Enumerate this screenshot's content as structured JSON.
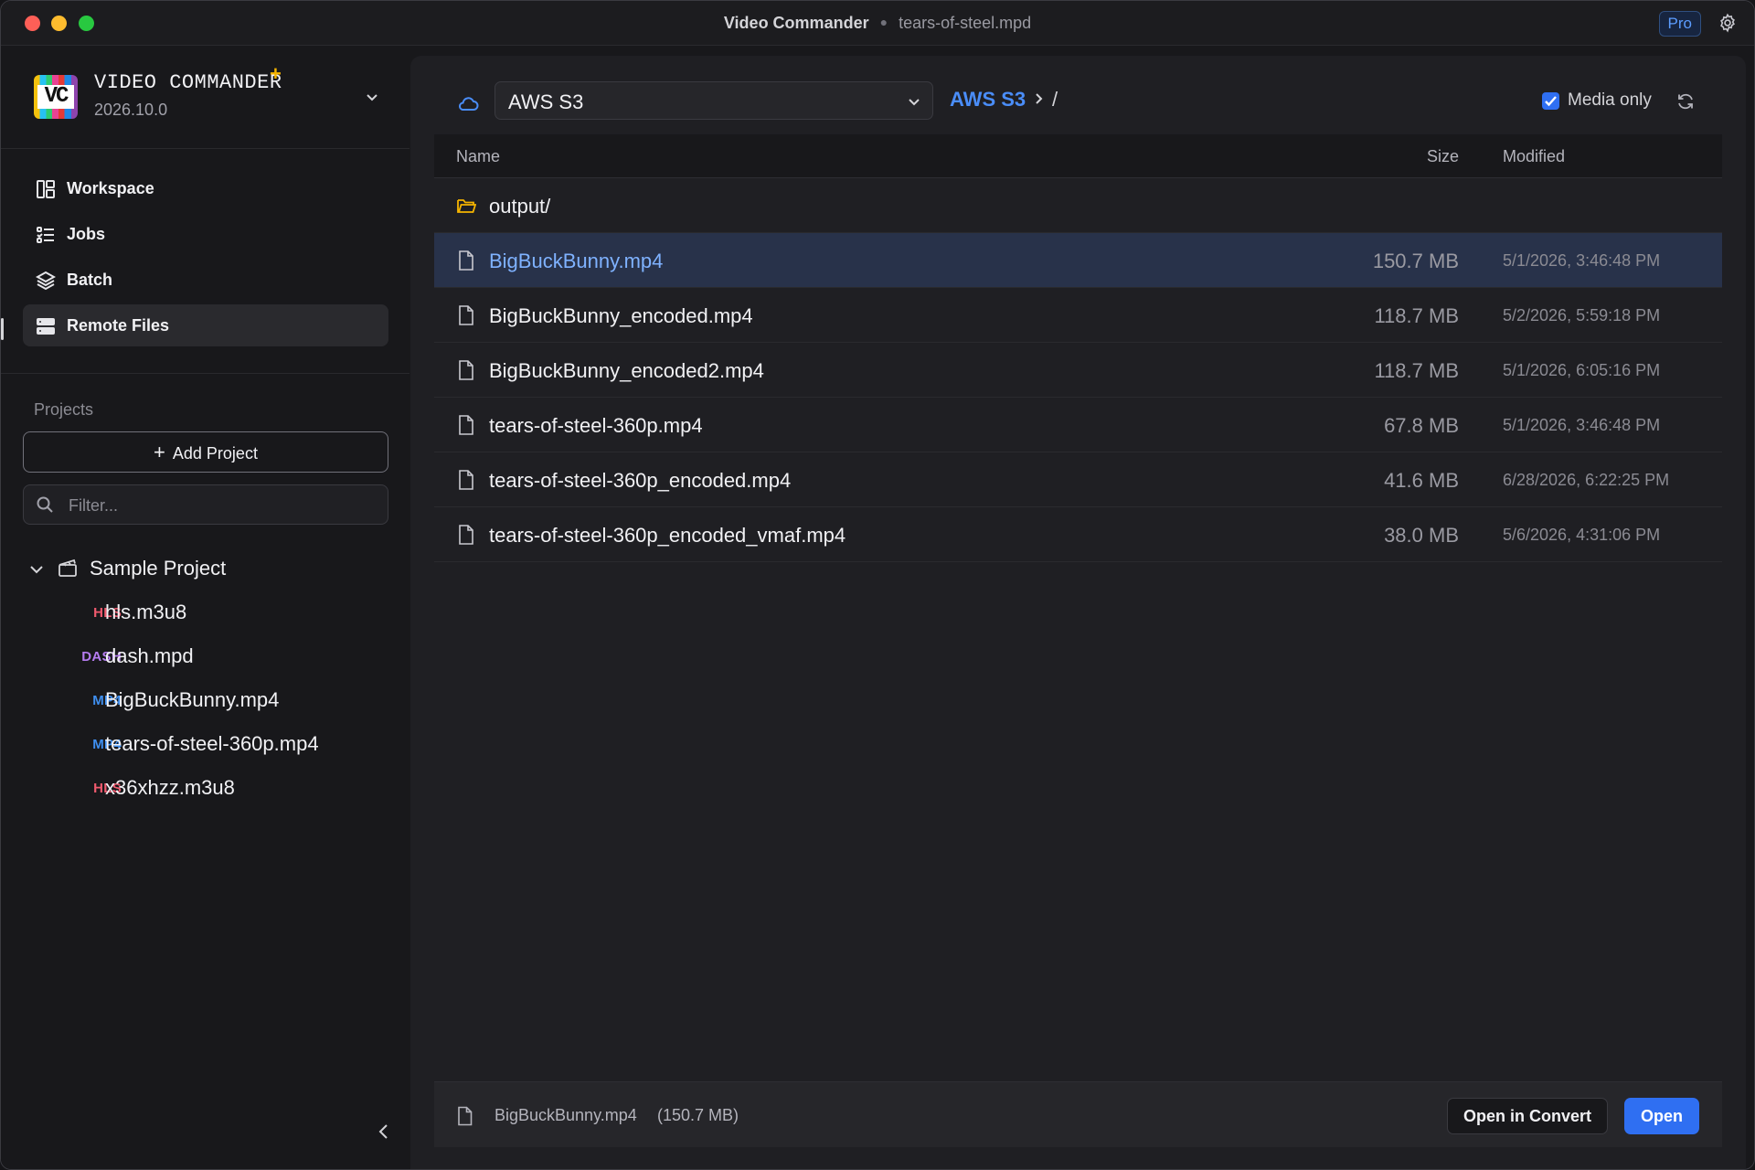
{
  "window": {
    "app_title": "Video Commander",
    "separator": "●",
    "document_title": "tears-of-steel.mpd",
    "pro_badge": "Pro"
  },
  "brand": {
    "logo_text": "VC",
    "name": "VIDEO COMMANDER",
    "star": "+",
    "version": "2026.10.0"
  },
  "nav": {
    "items": [
      {
        "label": "Workspace",
        "icon": "layout-icon",
        "active": false
      },
      {
        "label": "Jobs",
        "icon": "list-icon",
        "active": false
      },
      {
        "label": "Batch",
        "icon": "layers-icon",
        "active": false
      },
      {
        "label": "Remote Files",
        "icon": "server-icon",
        "active": true
      }
    ]
  },
  "projects": {
    "heading": "Projects",
    "add_label": "Add Project",
    "filter_placeholder": "Filter...",
    "tree": {
      "name": "Sample Project",
      "items": [
        {
          "badge": "HLS",
          "label": "hls.m3u8"
        },
        {
          "badge": "DASH",
          "label": "dash.mpd"
        },
        {
          "badge": "MP4",
          "label": "BigBuckBunny.mp4"
        },
        {
          "badge": "MP4",
          "label": "tears-of-steel-360p.mp4"
        },
        {
          "badge": "HLS",
          "label": "x36xhzz.m3u8"
        }
      ]
    }
  },
  "browser": {
    "source": "AWS S3",
    "breadcrumb_root": "AWS S3",
    "breadcrumb_path": "/",
    "media_only_label": "Media only",
    "media_only_checked": true,
    "columns": {
      "name": "Name",
      "size": "Size",
      "modified": "Modified"
    },
    "rows": [
      {
        "type": "folder",
        "name": "output/",
        "size": "",
        "modified": "",
        "selected": false
      },
      {
        "type": "file",
        "name": "BigBuckBunny.mp4",
        "size": "150.7 MB",
        "modified": "5/1/2026, 3:46:48 PM",
        "selected": true
      },
      {
        "type": "file",
        "name": "BigBuckBunny_encoded.mp4",
        "size": "118.7 MB",
        "modified": "5/2/2026, 5:59:18 PM",
        "selected": false
      },
      {
        "type": "file",
        "name": "BigBuckBunny_encoded2.mp4",
        "size": "118.7 MB",
        "modified": "5/1/2026, 6:05:16 PM",
        "selected": false
      },
      {
        "type": "file",
        "name": "tears-of-steel-360p.mp4",
        "size": "67.8 MB",
        "modified": "5/1/2026, 3:46:48 PM",
        "selected": false
      },
      {
        "type": "file",
        "name": "tears-of-steel-360p_encoded.mp4",
        "size": "41.6 MB",
        "modified": "6/28/2026, 6:22:25 PM",
        "selected": false
      },
      {
        "type": "file",
        "name": "tears-of-steel-360p_encoded_vmaf.mp4",
        "size": "38.0 MB",
        "modified": "5/6/2026, 4:31:06 PM",
        "selected": false
      }
    ]
  },
  "footer": {
    "selected_name": "BigBuckBunny.mp4",
    "selected_size": "(150.7 MB)",
    "convert_label": "Open in Convert",
    "open_label": "Open"
  },
  "colors": {
    "accent": "#2f6ff2",
    "link": "#4a8df8",
    "hls": "#f05a6e",
    "dash": "#b57cf0",
    "mp4": "#3f8ff0",
    "folder": "#f5b400"
  }
}
